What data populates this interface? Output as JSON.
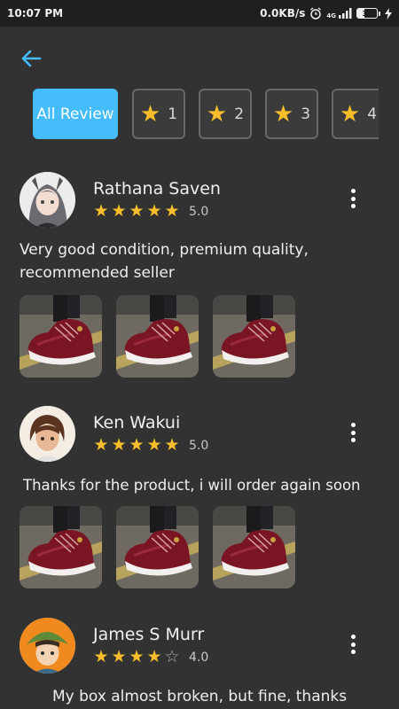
{
  "status_bar": {
    "time": "10:07 PM",
    "speed": "0.0KB/s",
    "network": "4G",
    "battery": "35",
    "battery_level": 0.35
  },
  "filters": [
    {
      "label": "All Review",
      "active": true
    },
    {
      "label": "1",
      "icon": "star-icon"
    },
    {
      "label": "2",
      "icon": "star-icon"
    },
    {
      "label": "3",
      "icon": "star-icon"
    },
    {
      "label": "4",
      "icon": "star-icon"
    }
  ],
  "reviews": [
    {
      "name": "Rathana Saven",
      "rating": 5,
      "score": "5.0",
      "text_line1": "Very good condition, premium quality,",
      "text_line2": "recommended seller",
      "photos": 3
    },
    {
      "name": "Ken Wakui",
      "rating": 5,
      "score": "5.0",
      "text_line1": "Thanks for the product, i will order again soon",
      "photos": 3
    },
    {
      "name": "James S Murr",
      "rating": 4,
      "score": "4.0",
      "text_line1": "My box almost broken, but fine, thanks"
    }
  ],
  "colors": {
    "background": "#323232",
    "accent": "#45bcfb",
    "star": "#fbbd2a",
    "statusbar": "#1f1f1f"
  }
}
